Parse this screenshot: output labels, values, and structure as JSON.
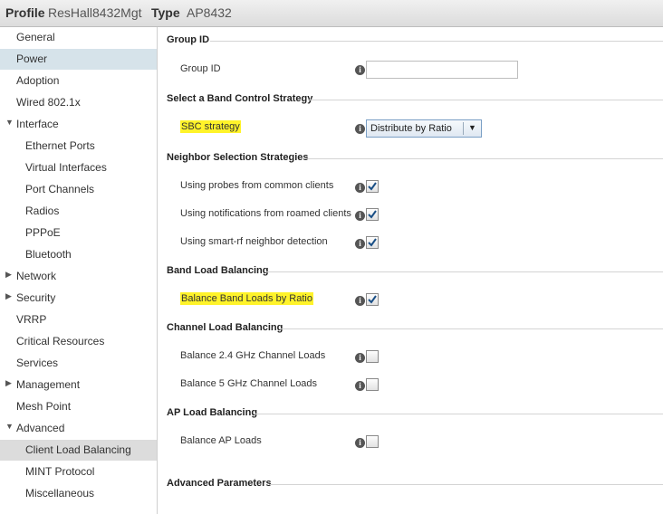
{
  "header": {
    "profile_label": "Profile",
    "profile_value": "ResHall8432Mgt",
    "type_label": "Type",
    "type_value": "AP8432"
  },
  "sidebar": {
    "items": [
      {
        "label": "General"
      },
      {
        "label": "Power"
      },
      {
        "label": "Adoption"
      },
      {
        "label": "Wired 802.1x"
      },
      {
        "label": "Interface"
      },
      {
        "label": "Ethernet Ports"
      },
      {
        "label": "Virtual Interfaces"
      },
      {
        "label": "Port Channels"
      },
      {
        "label": "Radios"
      },
      {
        "label": "PPPoE"
      },
      {
        "label": "Bluetooth"
      },
      {
        "label": "Network"
      },
      {
        "label": "Security"
      },
      {
        "label": "VRRP"
      },
      {
        "label": "Critical Resources"
      },
      {
        "label": "Services"
      },
      {
        "label": "Management"
      },
      {
        "label": "Mesh Point"
      },
      {
        "label": "Advanced"
      },
      {
        "label": "Client Load Balancing"
      },
      {
        "label": "MINT Protocol"
      },
      {
        "label": "Miscellaneous"
      }
    ]
  },
  "content": {
    "group_id": {
      "section": "Group ID",
      "label": "Group ID",
      "value": ""
    },
    "band_control": {
      "section": "Select a Band Control Strategy",
      "label": "SBC strategy",
      "selected": "Distribute by Ratio"
    },
    "neighbor": {
      "section": "Neighbor Selection Strategies",
      "items": [
        {
          "label": "Using probes from common clients",
          "checked": true
        },
        {
          "label": "Using notifications from roamed clients",
          "checked": true
        },
        {
          "label": "Using smart-rf neighbor detection",
          "checked": true
        }
      ]
    },
    "band_load": {
      "section": "Band Load Balancing",
      "label": "Balance Band Loads by Ratio",
      "checked": true
    },
    "channel_load": {
      "section": "Channel Load Balancing",
      "items": [
        {
          "label": "Balance 2.4 GHz Channel Loads",
          "checked": false
        },
        {
          "label": "Balance 5 GHz Channel Loads",
          "checked": false
        }
      ]
    },
    "ap_load": {
      "section": "AP Load Balancing",
      "label": "Balance AP Loads",
      "checked": false
    },
    "advanced": {
      "section": "Advanced Parameters"
    }
  },
  "colors": {
    "highlight": "#fff32a",
    "nav_selected": "#d6e3ea",
    "nav_active": "#dcdcdc",
    "check": "#1a4f86"
  }
}
